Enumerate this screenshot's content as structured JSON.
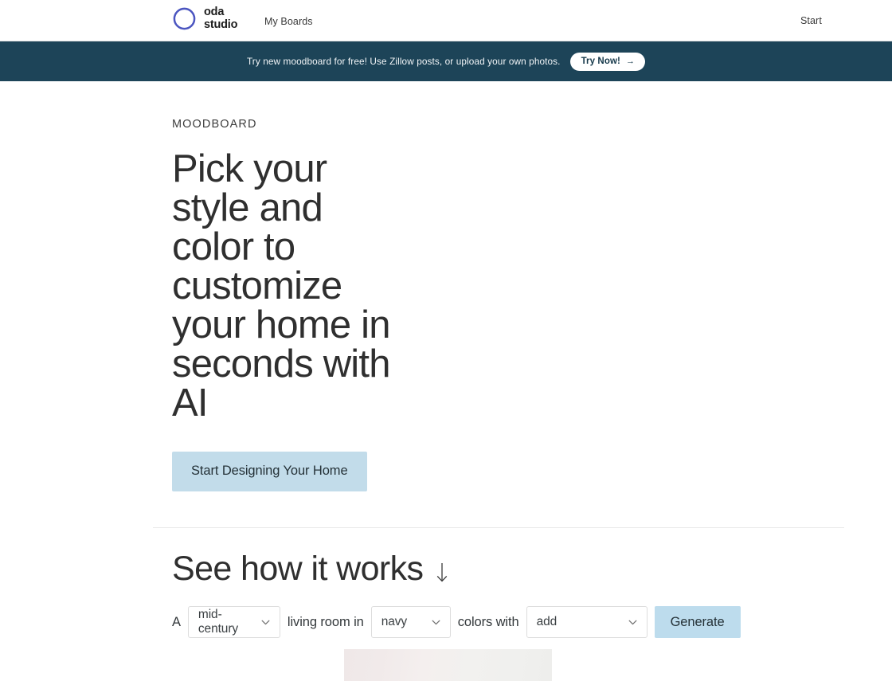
{
  "header": {
    "logo": {
      "icon": "circle-ring-logo-icon",
      "color": "#4b55c0",
      "name_line1": "oda",
      "name_line2": "studio",
      "name": "oda\nstudio"
    },
    "nav": {
      "my_boards": "My Boards",
      "start": "Start"
    }
  },
  "promo_banner": {
    "background": "#1d4458",
    "message": "Try new moodboard for free! Use Zillow posts, or upload your own photos.",
    "button_label": "Try Now!",
    "button_arrow": "→"
  },
  "hero": {
    "eyebrow": "MOODBOARD",
    "title": "Pick your style and color to customize your home in seconds with AI",
    "cta_label": "Start Designing Your Home",
    "cta_color": "#c2dcea"
  },
  "how_it_works": {
    "title": "See how it works",
    "arrow_icon": "arrow-down-icon",
    "prompt": {
      "lead_word": "A",
      "style_value": "mid-century",
      "middle_words": "living room in",
      "color_value": "navy",
      "trailing_words": "colors with",
      "extra_value": "add",
      "generate_label": "Generate",
      "generate_color": "#bddced"
    }
  }
}
